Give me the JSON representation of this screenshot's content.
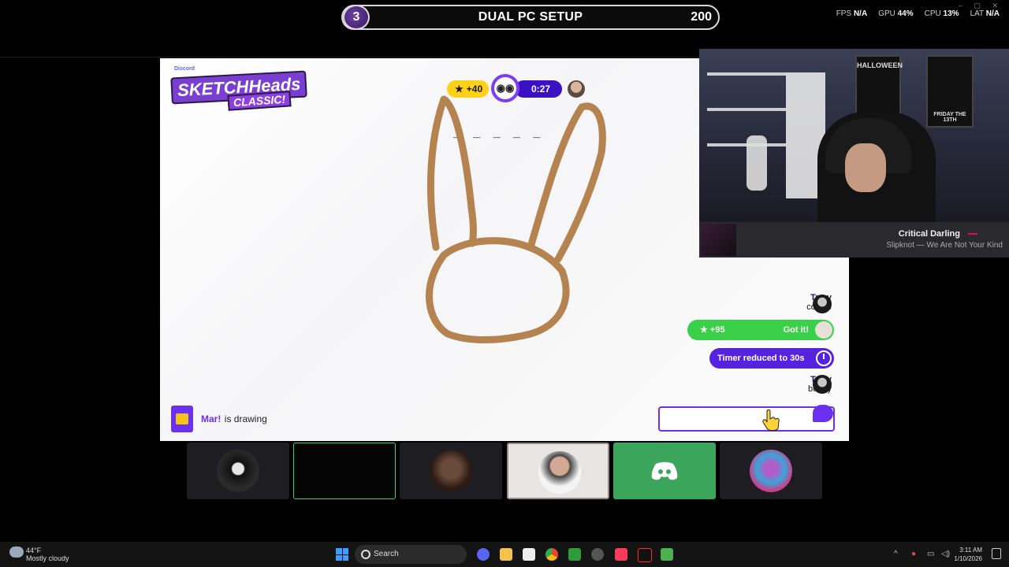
{
  "overlay": {
    "round": "3",
    "title": "DUAL PC SETUP",
    "score": "200",
    "stats": [
      {
        "label": "FPS",
        "value": "N/A"
      },
      {
        "label": "GPU",
        "value": "44%"
      },
      {
        "label": "CPU",
        "value": "13%"
      },
      {
        "label": "LAT",
        "value": "N/A"
      }
    ]
  },
  "game": {
    "logo_discord": "Discord",
    "logo_top": "SKETCHHeads",
    "logo_bottom": "CLASSIC!",
    "points_chip": "+40",
    "timer": "0:27",
    "word_blanks": "_ _ _ _ _",
    "drawer_name": "Mar!",
    "drawer_status": "is drawing",
    "stroke_color": "#b5834f",
    "accent_color": "#6b2ff0"
  },
  "chat": {
    "messages": [
      {
        "name": "Trrev",
        "text": "cookie"
      },
      {
        "name": "Trrev",
        "text": "bunny"
      }
    ],
    "got_it": {
      "points": "+95",
      "label": "Got it!"
    },
    "timer_reduced": "Timer reduced to 30s",
    "input_placeholder": ""
  },
  "now_playing": {
    "song": "Critical Darling",
    "artist": "Slipknot — We Are Not Your Kind"
  },
  "webcam": {
    "poster_1": "HALLOWEEN",
    "poster_2": "FRIDAY THE 13TH"
  },
  "taskbar": {
    "weather_temp": "44°F",
    "weather_desc": "Mostly cloudy",
    "search_label": "Search",
    "time": "3:11 AM",
    "date": "1/10/2026"
  }
}
